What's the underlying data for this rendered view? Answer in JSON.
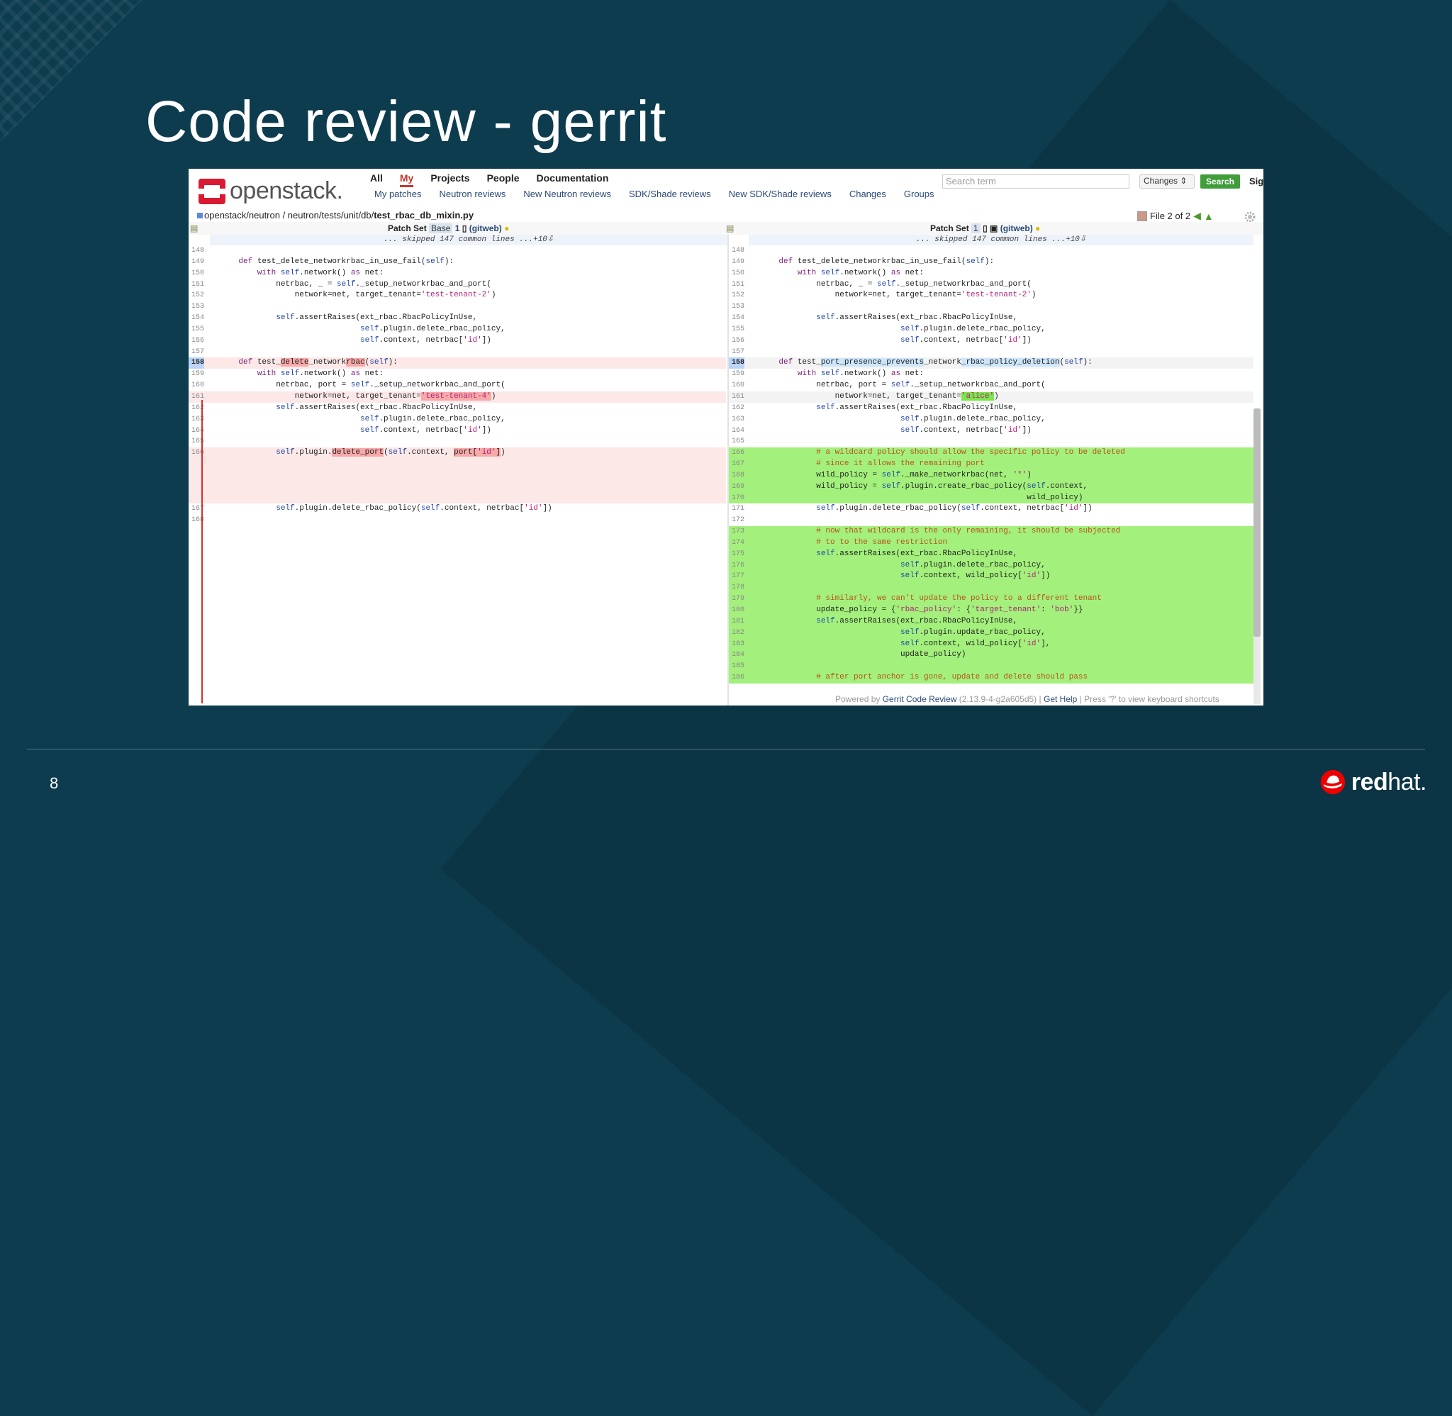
{
  "slide": {
    "title": "Code review - gerrit",
    "page_number": "8",
    "brand": {
      "bold": "red",
      "light": "hat."
    }
  },
  "gerrit": {
    "logo_text": "openstack.",
    "top_nav": [
      "All",
      "My",
      "Projects",
      "People",
      "Documentation"
    ],
    "active_top": "My",
    "sub_nav": [
      "My patches",
      "Neutron reviews",
      "New Neutron reviews",
      "SDK/Shade reviews",
      "New SDK/Shade reviews",
      "Changes",
      "Groups"
    ],
    "search_placeholder": "Search term",
    "changes_select": "Changes",
    "search_button": "Search",
    "sign_in": "Sig",
    "file_path_prefix": "openstack/neutron / neutron/tests/unit/db/",
    "file_name": "test_rbac_db_mixin.py",
    "file_nav": "File 2 of 2",
    "patch_left": {
      "label": "Patch Set",
      "base": "Base",
      "num": "1",
      "gitweb": "(gitweb)"
    },
    "patch_right": {
      "label": "Patch Set",
      "num": "1",
      "gitweb": "(gitweb)"
    },
    "skipped": "... skipped 147 common lines ...+10⇩",
    "footer": {
      "powered": "Powered by",
      "product": "Gerrit Code Review",
      "version": "(2.13.9-4-g2a605d5)",
      "sep": " | ",
      "help": "Get Help",
      "shortcut": "Press '?' to view keyboard shortcuts"
    }
  },
  "colors": {
    "slide_bg": "#0d3c4f",
    "added": "#a3f07c",
    "deleted": "#fde8e8",
    "redhat_red": "#ee0000"
  },
  "left_lines": [
    {
      "n": "148",
      "t": ""
    },
    {
      "n": "149",
      "t": "    def test_delete_networkrbac_in_use_fail(self):"
    },
    {
      "n": "150",
      "t": "        with self.network() as net:"
    },
    {
      "n": "151",
      "t": "            netrbac, _ = self._setup_networkrbac_and_port("
    },
    {
      "n": "152",
      "t": "                network=net, target_tenant='test-tenant-2')"
    },
    {
      "n": "153",
      "t": ""
    },
    {
      "n": "154",
      "t": "            self.assertRaises(ext_rbac.RbacPolicyInUse,"
    },
    {
      "n": "155",
      "t": "                              self.plugin.delete_rbac_policy,"
    },
    {
      "n": "156",
      "t": "                              self.context, netrbac['id'])"
    },
    {
      "n": "157",
      "t": ""
    },
    {
      "n": "158",
      "t": "    def test_delete_networkrbac(self):"
    },
    {
      "n": "159",
      "t": "        with self.network() as net:"
    },
    {
      "n": "160",
      "t": "            netrbac, port = self._setup_networkrbac_and_port("
    },
    {
      "n": "161",
      "t": "                network=net, target_tenant='test-tenant-4')"
    },
    {
      "n": "162",
      "t": "            self.assertRaises(ext_rbac.RbacPolicyInUse,"
    },
    {
      "n": "163",
      "t": "                              self.plugin.delete_rbac_policy,"
    },
    {
      "n": "164",
      "t": "                              self.context, netrbac['id'])"
    },
    {
      "n": "165",
      "t": ""
    },
    {
      "n": "166",
      "t": "            self.plugin.delete_port(self.context, port['id'])"
    },
    {
      "n": "",
      "t": ""
    },
    {
      "n": "",
      "t": ""
    },
    {
      "n": "",
      "t": ""
    },
    {
      "n": "",
      "t": ""
    },
    {
      "n": "167",
      "t": "            self.plugin.delete_rbac_policy(self.context, netrbac['id'])"
    },
    {
      "n": "168",
      "t": ""
    }
  ],
  "right_lines": [
    {
      "n": "148",
      "t": ""
    },
    {
      "n": "149",
      "t": "    def test_delete_networkrbac_in_use_fail(self):"
    },
    {
      "n": "150",
      "t": "        with self.network() as net:"
    },
    {
      "n": "151",
      "t": "            netrbac, _ = self._setup_networkrbac_and_port("
    },
    {
      "n": "152",
      "t": "                network=net, target_tenant='test-tenant-2')"
    },
    {
      "n": "153",
      "t": ""
    },
    {
      "n": "154",
      "t": "            self.assertRaises(ext_rbac.RbacPolicyInUse,"
    },
    {
      "n": "155",
      "t": "                              self.plugin.delete_rbac_policy,"
    },
    {
      "n": "156",
      "t": "                              self.context, netrbac['id'])"
    },
    {
      "n": "157",
      "t": ""
    },
    {
      "n": "158",
      "t": "    def test_port_presence_prevents_network_rbac_policy_deletion(self):"
    },
    {
      "n": "159",
      "t": "        with self.network() as net:"
    },
    {
      "n": "160",
      "t": "            netrbac, port = self._setup_networkrbac_and_port("
    },
    {
      "n": "161",
      "t": "                network=net, target_tenant='alice')"
    },
    {
      "n": "162",
      "t": "            self.assertRaises(ext_rbac.RbacPolicyInUse,"
    },
    {
      "n": "163",
      "t": "                              self.plugin.delete_rbac_policy,"
    },
    {
      "n": "164",
      "t": "                              self.context, netrbac['id'])"
    },
    {
      "n": "165",
      "t": ""
    },
    {
      "n": "166",
      "t": "            # a wildcard policy should allow the specific policy to be deleted"
    },
    {
      "n": "167",
      "t": "            # since it allows the remaining port"
    },
    {
      "n": "168",
      "t": "            wild_policy = self._make_networkrbac(net, '*')"
    },
    {
      "n": "169",
      "t": "            wild_policy = self.plugin.create_rbac_policy(self.context,"
    },
    {
      "n": "170",
      "t": "                                                         wild_policy)"
    },
    {
      "n": "171",
      "t": "            self.plugin.delete_rbac_policy(self.context, netrbac['id'])"
    },
    {
      "n": "172",
      "t": ""
    },
    {
      "n": "173",
      "t": "            # now that wildcard is the only remaining, it should be subjected"
    },
    {
      "n": "174",
      "t": "            # to to the same restriction"
    },
    {
      "n": "175",
      "t": "            self.assertRaises(ext_rbac.RbacPolicyInUse,"
    },
    {
      "n": "176",
      "t": "                              self.plugin.delete_rbac_policy,"
    },
    {
      "n": "177",
      "t": "                              self.context, wild_policy['id'])"
    },
    {
      "n": "178",
      "t": ""
    },
    {
      "n": "179",
      "t": "            # similarly, we can't update the policy to a different tenant"
    },
    {
      "n": "180",
      "t": "            update_policy = {'rbac_policy': {'target_tenant': 'bob'}}"
    },
    {
      "n": "181",
      "t": "            self.assertRaises(ext_rbac.RbacPolicyInUse,"
    },
    {
      "n": "182",
      "t": "                              self.plugin.update_rbac_policy,"
    },
    {
      "n": "183",
      "t": "                              self.context, wild_policy['id'],"
    },
    {
      "n": "184",
      "t": "                              update_policy)"
    },
    {
      "n": "185",
      "t": ""
    },
    {
      "n": "186",
      "t": "            # after port anchor is gone, update and delete should pass"
    }
  ]
}
